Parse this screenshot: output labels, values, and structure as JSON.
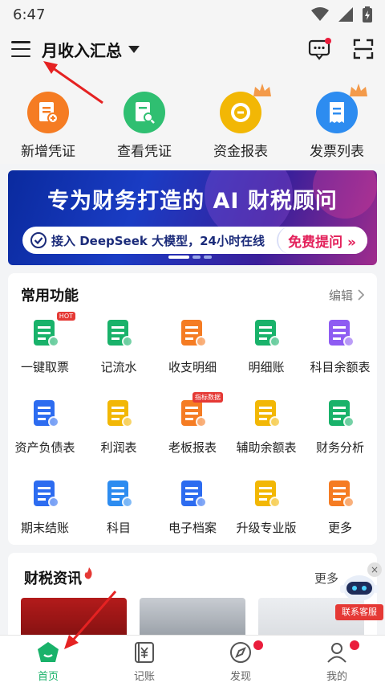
{
  "status_bar": {
    "time": "6:47"
  },
  "header": {
    "title": "月收入汇总"
  },
  "quick_actions": [
    {
      "label": "新增凭证",
      "color": "#f57c23",
      "icon": "add-voucher-icon"
    },
    {
      "label": "查看凭证",
      "color": "#2fbf71",
      "icon": "view-voucher-icon"
    },
    {
      "label": "资金报表",
      "color": "#f2b705",
      "icon": "fund-report-icon"
    },
    {
      "label": "发票列表",
      "color": "#2d8cf0",
      "icon": "invoice-list-icon"
    }
  ],
  "banner": {
    "title": "专为财务打造的 AI 财税顾问",
    "subtitle": "接入 DeepSeek 大模型，24小时在线",
    "cta": "免费提问 »"
  },
  "features": {
    "title": "常用功能",
    "edit_label": "编辑",
    "items": [
      {
        "label": "一键取票",
        "icon": "ticket-icon",
        "color": "#19b26a",
        "tag": "HOT"
      },
      {
        "label": "记流水",
        "icon": "cash-flow-icon",
        "color": "#19b26a"
      },
      {
        "label": "收支明细",
        "icon": "income-expense-icon",
        "color": "#f57c23"
      },
      {
        "label": "明细账",
        "icon": "ledger-icon",
        "color": "#19b26a"
      },
      {
        "label": "科目余额表",
        "icon": "account-balance-icon",
        "color": "#8e5cf2"
      },
      {
        "label": "资产负债表",
        "icon": "balance-sheet-icon",
        "color": "#2d6cf0"
      },
      {
        "label": "利润表",
        "icon": "profit-icon",
        "color": "#f2b705"
      },
      {
        "label": "老板报表",
        "icon": "boss-report-icon",
        "color": "#f57c23",
        "tag": "指标数据"
      },
      {
        "label": "辅助余额表",
        "icon": "aux-balance-icon",
        "color": "#f2b705"
      },
      {
        "label": "财务分析",
        "icon": "finance-analysis-icon",
        "color": "#19b26a"
      },
      {
        "label": "期末结账",
        "icon": "period-close-icon",
        "color": "#2d6cf0"
      },
      {
        "label": "科目",
        "icon": "subject-icon",
        "color": "#2d8cf0"
      },
      {
        "label": "电子档案",
        "icon": "e-archive-icon",
        "color": "#2d6cf0"
      },
      {
        "label": "升级专业版",
        "icon": "upgrade-icon",
        "color": "#f2b705"
      },
      {
        "label": "更多",
        "icon": "more-icon",
        "color": "#f57c23"
      }
    ]
  },
  "news": {
    "title": "财税资讯",
    "more_label": "更多"
  },
  "customer_service": {
    "label": "联系客服"
  },
  "tabs": [
    {
      "label": "首页",
      "icon": "home-icon",
      "active": true
    },
    {
      "label": "记账",
      "icon": "bookkeeping-icon"
    },
    {
      "label": "发现",
      "icon": "discover-icon",
      "dot": true
    },
    {
      "label": "我的",
      "icon": "profile-icon",
      "dot": true
    }
  ]
}
